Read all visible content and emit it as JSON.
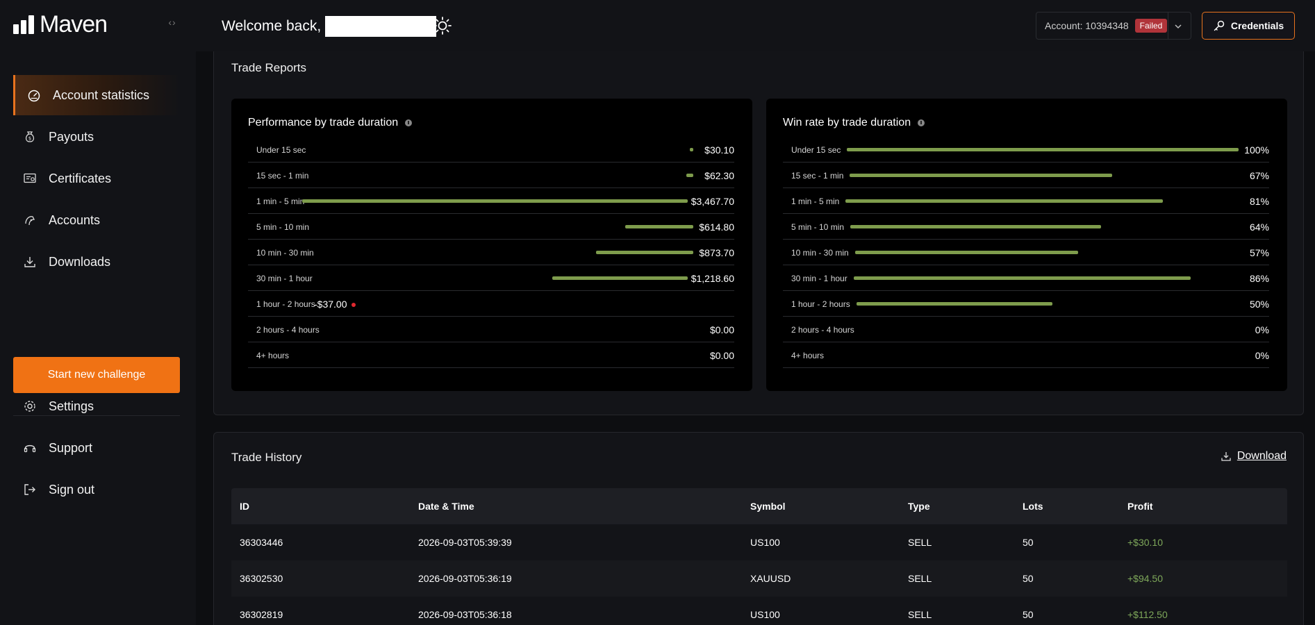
{
  "app": {
    "logo_text": "Maven",
    "collapse_glyph": "‹›"
  },
  "header": {
    "welcome": "Welcome back,",
    "account_label": "Account: 10394348",
    "account_status": "Failed",
    "credentials_label": "Credentials"
  },
  "sidebar": {
    "items": [
      {
        "label": "Account statistics",
        "icon": "gauge-icon"
      },
      {
        "label": "Payouts",
        "icon": "money-bag-icon"
      },
      {
        "label": "Certificates",
        "icon": "certificate-icon"
      },
      {
        "label": "Accounts",
        "icon": "accounts-icon"
      },
      {
        "label": "Downloads",
        "icon": "download-icon"
      }
    ],
    "start_button": "Start new challenge",
    "bottom_items": [
      {
        "label": "Settings",
        "icon": "gear-icon"
      },
      {
        "label": "Support",
        "icon": "headset-icon"
      },
      {
        "label": "Sign out",
        "icon": "sign-out-icon"
      }
    ]
  },
  "reports": {
    "title": "Trade Reports",
    "performance": {
      "title": "Performance by trade duration",
      "rows": [
        {
          "label": "Under 15 sec",
          "value": "$30.10",
          "amount": 30.1
        },
        {
          "label": "15 sec - 1 min",
          "value": "$62.30",
          "amount": 62.3
        },
        {
          "label": "1 min - 5 min",
          "value": "$3,467.70",
          "amount": 3467.7
        },
        {
          "label": "5 min - 10 min",
          "value": "$614.80",
          "amount": 614.8
        },
        {
          "label": "10 min - 30 min",
          "value": "$873.70",
          "amount": 873.7
        },
        {
          "label": "30 min - 1 hour",
          "value": "$1,218.60",
          "amount": 1218.6
        },
        {
          "label": "1 hour - 2 hours",
          "value": "-$37.00",
          "amount": -37.0
        },
        {
          "label": "2 hours - 4 hours",
          "value": "$0.00",
          "amount": 0
        },
        {
          "label": "4+ hours",
          "value": "$0.00",
          "amount": 0
        }
      ]
    },
    "winrate": {
      "title": "Win rate by trade duration",
      "rows": [
        {
          "label": "Under 15 sec",
          "value": "100%",
          "rate": 1.0
        },
        {
          "label": "15 sec - 1 min",
          "value": "67%",
          "rate": 0.67
        },
        {
          "label": "1 min - 5 min",
          "value": "81%",
          "rate": 0.81
        },
        {
          "label": "5 min - 10 min",
          "value": "64%",
          "rate": 0.64
        },
        {
          "label": "10 min - 30 min",
          "value": "57%",
          "rate": 0.57
        },
        {
          "label": "30 min - 1 hour",
          "value": "86%",
          "rate": 0.86
        },
        {
          "label": "1 hour - 2 hours",
          "value": "50%",
          "rate": 0.5
        },
        {
          "label": "2 hours - 4 hours",
          "value": "0%",
          "rate": 0
        },
        {
          "label": "4+ hours",
          "value": "0%",
          "rate": 0
        }
      ]
    }
  },
  "history": {
    "title": "Trade History",
    "download_label": "Download",
    "columns": [
      "ID",
      "Date & Time",
      "Symbol",
      "Type",
      "Lots",
      "Profit"
    ],
    "rows": [
      [
        "36303446",
        "2026-09-03T05:39:39",
        "US100",
        "SELL",
        "50",
        "+$30.10"
      ],
      [
        "36302530",
        "2026-09-03T05:36:19",
        "XAUUSD",
        "SELL",
        "50",
        "+$94.50"
      ],
      [
        "36302819",
        "2026-09-03T05:36:18",
        "US100",
        "SELL",
        "50",
        "+$112.50"
      ]
    ]
  },
  "colors": {
    "accent": "#f07214",
    "bar": "#7e9c4c",
    "failed": "#b0343a",
    "negative_dot": "#e0282f",
    "profit": "#7ea85a"
  }
}
